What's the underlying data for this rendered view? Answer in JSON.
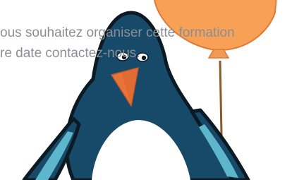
{
  "text": {
    "line1": "ous souhaitez organiser cette formation",
    "line2": "re date contactez-nous."
  },
  "colors": {
    "balloon": "#F8A055",
    "balloon_outline": "#E07A38",
    "string": "#8B5A2B",
    "penguin_body": "#174A68",
    "penguin_outline": "#0C1A24",
    "penguin_belly": "#FFFFFF",
    "penguin_flipper": "#5DB6CC",
    "beak": "#E8743A",
    "text": "#8A8F96"
  },
  "illustration": {
    "subjects": [
      "penguin",
      "balloon"
    ]
  }
}
